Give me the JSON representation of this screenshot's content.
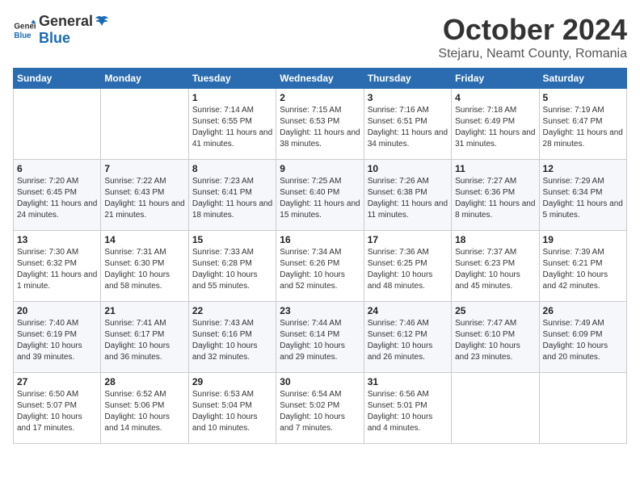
{
  "header": {
    "logo_general": "General",
    "logo_blue": "Blue",
    "title": "October 2024",
    "location": "Stejaru, Neamt County, Romania"
  },
  "weekdays": [
    "Sunday",
    "Monday",
    "Tuesday",
    "Wednesday",
    "Thursday",
    "Friday",
    "Saturday"
  ],
  "weeks": [
    [
      {
        "day": "",
        "info": ""
      },
      {
        "day": "",
        "info": ""
      },
      {
        "day": "1",
        "info": "Sunrise: 7:14 AM\nSunset: 6:55 PM\nDaylight: 11 hours and 41 minutes."
      },
      {
        "day": "2",
        "info": "Sunrise: 7:15 AM\nSunset: 6:53 PM\nDaylight: 11 hours and 38 minutes."
      },
      {
        "day": "3",
        "info": "Sunrise: 7:16 AM\nSunset: 6:51 PM\nDaylight: 11 hours and 34 minutes."
      },
      {
        "day": "4",
        "info": "Sunrise: 7:18 AM\nSunset: 6:49 PM\nDaylight: 11 hours and 31 minutes."
      },
      {
        "day": "5",
        "info": "Sunrise: 7:19 AM\nSunset: 6:47 PM\nDaylight: 11 hours and 28 minutes."
      }
    ],
    [
      {
        "day": "6",
        "info": "Sunrise: 7:20 AM\nSunset: 6:45 PM\nDaylight: 11 hours and 24 minutes."
      },
      {
        "day": "7",
        "info": "Sunrise: 7:22 AM\nSunset: 6:43 PM\nDaylight: 11 hours and 21 minutes."
      },
      {
        "day": "8",
        "info": "Sunrise: 7:23 AM\nSunset: 6:41 PM\nDaylight: 11 hours and 18 minutes."
      },
      {
        "day": "9",
        "info": "Sunrise: 7:25 AM\nSunset: 6:40 PM\nDaylight: 11 hours and 15 minutes."
      },
      {
        "day": "10",
        "info": "Sunrise: 7:26 AM\nSunset: 6:38 PM\nDaylight: 11 hours and 11 minutes."
      },
      {
        "day": "11",
        "info": "Sunrise: 7:27 AM\nSunset: 6:36 PM\nDaylight: 11 hours and 8 minutes."
      },
      {
        "day": "12",
        "info": "Sunrise: 7:29 AM\nSunset: 6:34 PM\nDaylight: 11 hours and 5 minutes."
      }
    ],
    [
      {
        "day": "13",
        "info": "Sunrise: 7:30 AM\nSunset: 6:32 PM\nDaylight: 11 hours and 1 minute."
      },
      {
        "day": "14",
        "info": "Sunrise: 7:31 AM\nSunset: 6:30 PM\nDaylight: 10 hours and 58 minutes."
      },
      {
        "day": "15",
        "info": "Sunrise: 7:33 AM\nSunset: 6:28 PM\nDaylight: 10 hours and 55 minutes."
      },
      {
        "day": "16",
        "info": "Sunrise: 7:34 AM\nSunset: 6:26 PM\nDaylight: 10 hours and 52 minutes."
      },
      {
        "day": "17",
        "info": "Sunrise: 7:36 AM\nSunset: 6:25 PM\nDaylight: 10 hours and 48 minutes."
      },
      {
        "day": "18",
        "info": "Sunrise: 7:37 AM\nSunset: 6:23 PM\nDaylight: 10 hours and 45 minutes."
      },
      {
        "day": "19",
        "info": "Sunrise: 7:39 AM\nSunset: 6:21 PM\nDaylight: 10 hours and 42 minutes."
      }
    ],
    [
      {
        "day": "20",
        "info": "Sunrise: 7:40 AM\nSunset: 6:19 PM\nDaylight: 10 hours and 39 minutes."
      },
      {
        "day": "21",
        "info": "Sunrise: 7:41 AM\nSunset: 6:17 PM\nDaylight: 10 hours and 36 minutes."
      },
      {
        "day": "22",
        "info": "Sunrise: 7:43 AM\nSunset: 6:16 PM\nDaylight: 10 hours and 32 minutes."
      },
      {
        "day": "23",
        "info": "Sunrise: 7:44 AM\nSunset: 6:14 PM\nDaylight: 10 hours and 29 minutes."
      },
      {
        "day": "24",
        "info": "Sunrise: 7:46 AM\nSunset: 6:12 PM\nDaylight: 10 hours and 26 minutes."
      },
      {
        "day": "25",
        "info": "Sunrise: 7:47 AM\nSunset: 6:10 PM\nDaylight: 10 hours and 23 minutes."
      },
      {
        "day": "26",
        "info": "Sunrise: 7:49 AM\nSunset: 6:09 PM\nDaylight: 10 hours and 20 minutes."
      }
    ],
    [
      {
        "day": "27",
        "info": "Sunrise: 6:50 AM\nSunset: 5:07 PM\nDaylight: 10 hours and 17 minutes."
      },
      {
        "day": "28",
        "info": "Sunrise: 6:52 AM\nSunset: 5:06 PM\nDaylight: 10 hours and 14 minutes."
      },
      {
        "day": "29",
        "info": "Sunrise: 6:53 AM\nSunset: 5:04 PM\nDaylight: 10 hours and 10 minutes."
      },
      {
        "day": "30",
        "info": "Sunrise: 6:54 AM\nSunset: 5:02 PM\nDaylight: 10 hours and 7 minutes."
      },
      {
        "day": "31",
        "info": "Sunrise: 6:56 AM\nSunset: 5:01 PM\nDaylight: 10 hours and 4 minutes."
      },
      {
        "day": "",
        "info": ""
      },
      {
        "day": "",
        "info": ""
      }
    ]
  ]
}
